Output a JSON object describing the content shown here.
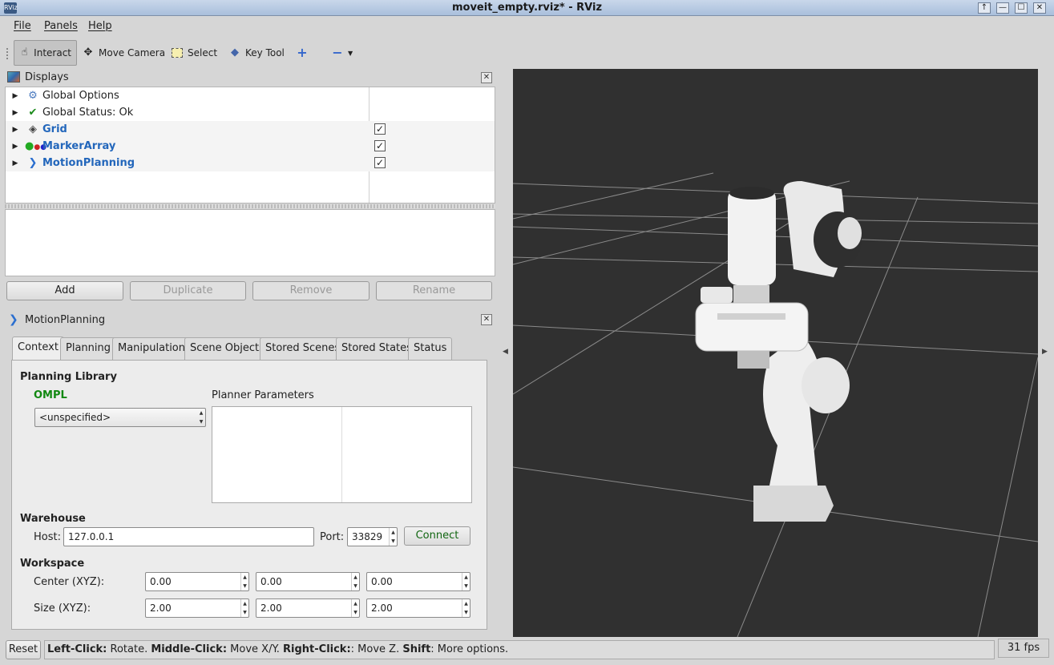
{
  "window": {
    "title": "moveit_empty.rviz* - RViz",
    "app_icon": "RViz",
    "controls": [
      "↑",
      "—",
      "☐",
      "✕"
    ]
  },
  "menu": [
    "File",
    "Panels",
    "Help"
  ],
  "toolbar": {
    "interact": "Interact",
    "move_camera": "Move Camera",
    "select": "Select",
    "key_tool": "Key Tool",
    "add_icon": "plus-icon",
    "overflow_icon": "minus-dropdown-icon"
  },
  "displays": {
    "title": "Displays",
    "items": [
      {
        "label": "Global Options",
        "icon": "gear-icon",
        "checked": null,
        "blue": false
      },
      {
        "label": "Global Status: Ok",
        "icon": "checkmark-icon",
        "checked": null,
        "blue": false
      },
      {
        "label": "Grid",
        "icon": "grid-icon",
        "checked": true,
        "blue": true
      },
      {
        "label": "MarkerArray",
        "icon": "markers-icon",
        "checked": true,
        "blue": true
      },
      {
        "label": "MotionPlanning",
        "icon": "motion-icon",
        "checked": true,
        "blue": true
      }
    ],
    "buttons": {
      "add": "Add",
      "duplicate": "Duplicate",
      "remove": "Remove",
      "rename": "Rename"
    }
  },
  "motion": {
    "title": "MotionPlanning",
    "tabs": [
      "Context",
      "Planning",
      "Manipulation",
      "Scene Objects",
      "Stored Scenes",
      "Stored States",
      "Status"
    ],
    "selected_tab": "Context",
    "planning_library": "Planning Library",
    "ompl": "OMPL",
    "planner_select": "<unspecified>",
    "planner_params": "Planner Parameters",
    "warehouse": "Warehouse",
    "host_label": "Host:",
    "host": "127.0.0.1",
    "port_label": "Port:",
    "port": "33829",
    "connect": "Connect",
    "workspace": "Workspace",
    "center_label": "Center (XYZ):",
    "center": [
      "0.00",
      "0.00",
      "0.00"
    ],
    "size_label": "Size (XYZ):",
    "size": [
      "2.00",
      "2.00",
      "2.00"
    ]
  },
  "status": {
    "reset": "Reset",
    "lc": "Left-Click:",
    "lc_t": " Rotate. ",
    "mc": "Middle-Click:",
    "mc_t": " Move X/Y. ",
    "rc": "Right-Click:",
    "rc_t": ": Move Z. ",
    "sh": "Shift",
    "sh_t": ": More options.",
    "fps": "31 fps"
  },
  "colors": {
    "accent": "#2266bb",
    "ompl": "#118811",
    "connect": "#116611",
    "viewport": "#303030"
  }
}
